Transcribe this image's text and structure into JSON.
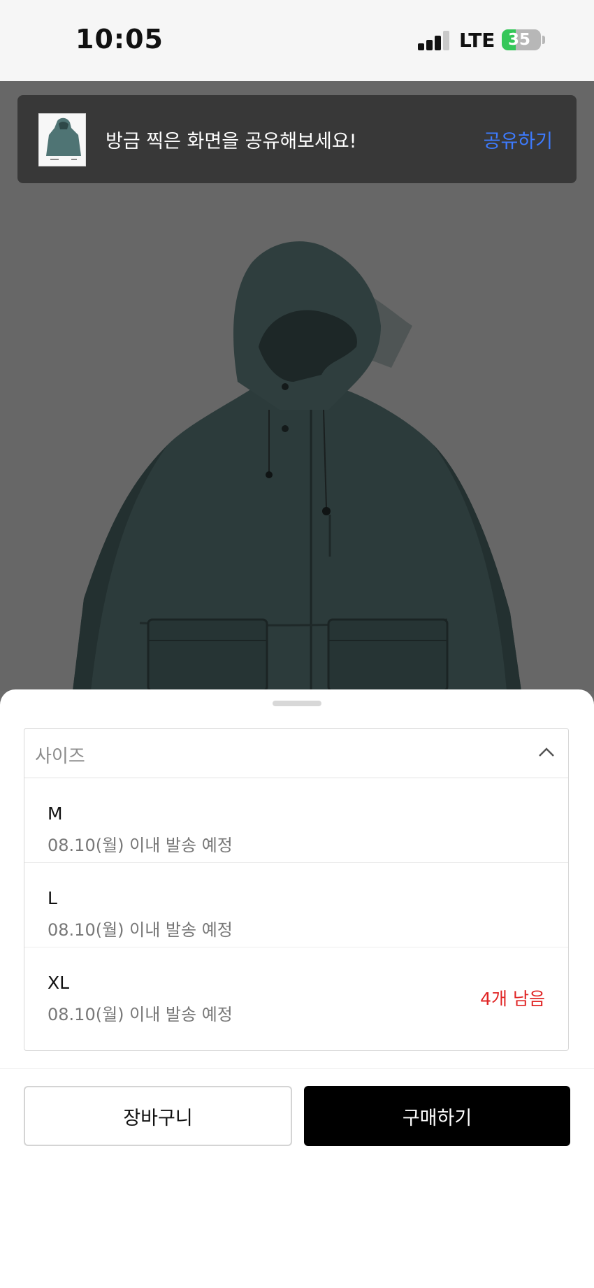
{
  "status_bar": {
    "time": "10:05",
    "network": "LTE",
    "battery": "35",
    "battery_level_percent": 35,
    "icons": [
      "signal-icon",
      "battery-charging-icon"
    ]
  },
  "share_toast": {
    "message": "방금 찍은 화면을 공유해보세요!",
    "action_label": "공유하기",
    "action_color": "#3d7bff"
  },
  "size_selector": {
    "placeholder": "사이즈",
    "expanded": true,
    "options": [
      {
        "size": "M",
        "shipping": "08.10(월) 이내 발송 예정",
        "stock": ""
      },
      {
        "size": "L",
        "shipping": "08.10(월) 이내 발송 예정",
        "stock": ""
      },
      {
        "size": "XL",
        "shipping": "08.10(월) 이내 발송 예정",
        "stock": "4개 남음"
      }
    ],
    "stock_color": "#e02424"
  },
  "actions": {
    "cart_label": "장바구니",
    "buy_label": "구매하기"
  },
  "colors": {
    "overlay": "#676767",
    "toast_bg": "#383838",
    "jacket": "#2b3a3a"
  }
}
